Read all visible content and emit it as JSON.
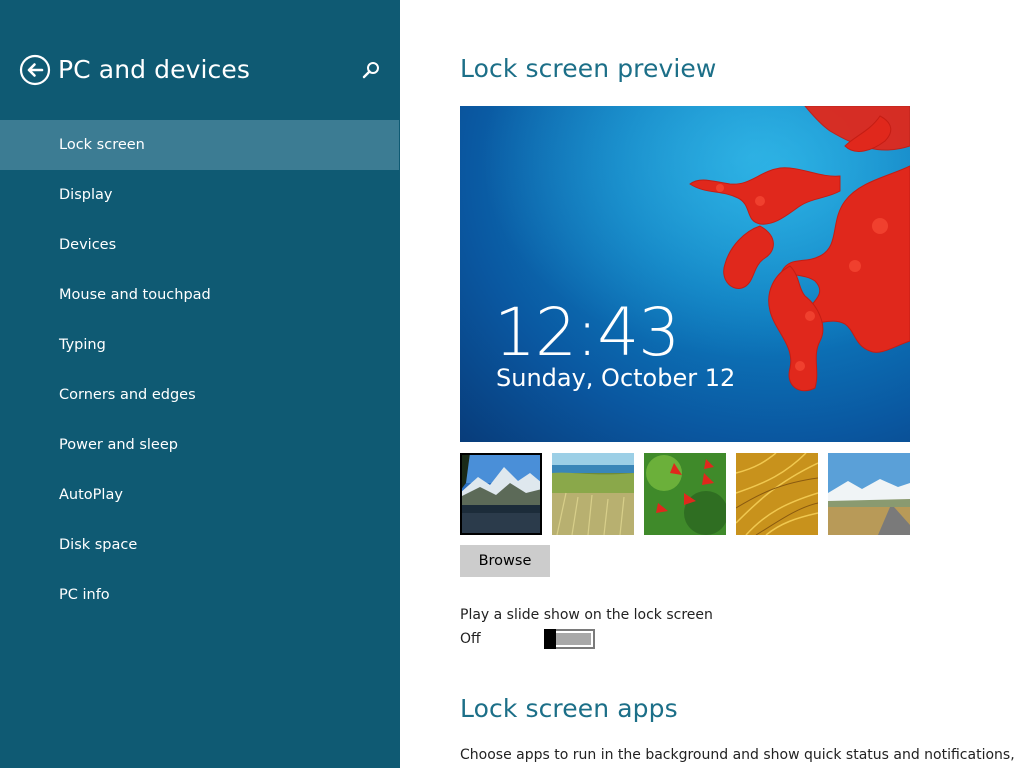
{
  "sidebar": {
    "title": "PC and devices",
    "back_icon": "back-arrow-icon",
    "search_icon": "search-icon",
    "items": [
      {
        "label": "Lock screen",
        "selected": true
      },
      {
        "label": "Display"
      },
      {
        "label": "Devices"
      },
      {
        "label": "Mouse and touchpad"
      },
      {
        "label": "Typing"
      },
      {
        "label": "Corners and edges"
      },
      {
        "label": "Power and sleep"
      },
      {
        "label": "AutoPlay"
      },
      {
        "label": "Disk space"
      },
      {
        "label": "PC info"
      }
    ]
  },
  "main": {
    "preview_heading": "Lock screen preview",
    "preview": {
      "time": "12:43",
      "date": "Sunday, October 12"
    },
    "browse_label": "Browse",
    "slideshow": {
      "label": "Play a slide show on the lock screen",
      "state": "Off"
    },
    "apps_heading": "Lock screen apps",
    "apps_description": "Choose apps to run in the background and show quick status and notifications,"
  },
  "colors": {
    "sidebar_bg": "#0f5a73",
    "sidebar_selected": "#3c7c93",
    "heading": "#1c6f88"
  }
}
